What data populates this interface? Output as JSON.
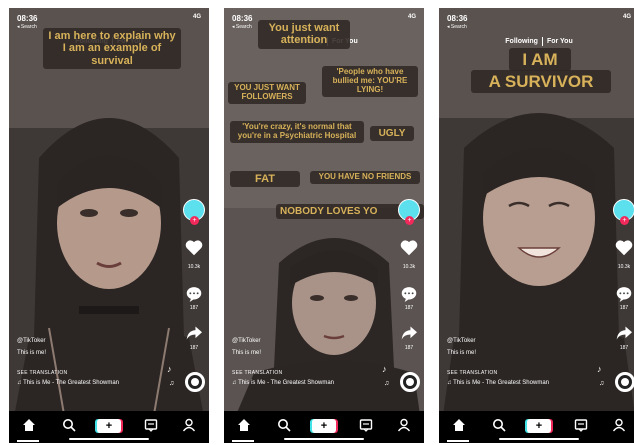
{
  "shared": {
    "time": "08:36",
    "network": "4G",
    "back_label": "◂ Search",
    "tab_following": "Following",
    "tab_for_you": "For You",
    "handle": "@TikToker",
    "description": "This is me!",
    "see_translation": "SEE TRANSLATION",
    "music": "This is Me - The Greatest Showman",
    "likes": "10.3k",
    "comments": "187",
    "shares": "187"
  },
  "panels": [
    {
      "captions": [
        "I am here to explain why I am an example of survival"
      ]
    },
    {
      "captions": [
        "You just want attention",
        "YOU JUST WANT FOLLOWERS",
        "'People who have bullied me: YOU'RE LYING!",
        "'You're crazy, it's normal that you're in a Psychiatric Hospital",
        "UGLY",
        "FAT",
        "YOU HAVE NO FRIENDS",
        "NOBODY LOVES YO"
      ]
    },
    {
      "captions": [
        "I AM",
        "A SURVIVOR"
      ]
    }
  ],
  "colors": {
    "caption_text": "#d7b25a",
    "caption_bg": "#302824",
    "avatar": "#5ce0ee",
    "accent_red": "#f2295b",
    "accent_cyan": "#41e3e8"
  }
}
